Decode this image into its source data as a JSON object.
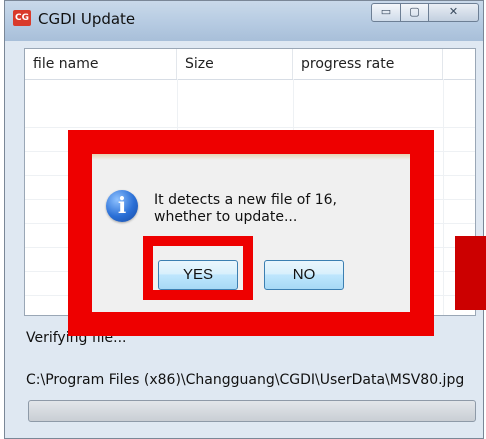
{
  "window": {
    "title": "CGDI Update",
    "icon_text": "CG",
    "min_glyph": "▭",
    "max_glyph": "▢",
    "close_glyph": "✕"
  },
  "list": {
    "columns": [
      "file name",
      "Size",
      "progress rate"
    ]
  },
  "status": {
    "text": "Verifying file...",
    "path": "C:\\Program Files (x86)\\Changguang\\CGDI\\UserData\\MSV80.jpg",
    "progress": 0
  },
  "dialog": {
    "icon": "info-icon",
    "icon_glyph": "i",
    "message": "It detects a new file of 16, whether to update...",
    "yes_label": "YES",
    "no_label": "NO"
  },
  "colors": {
    "highlight": "#ee0000",
    "button_border": "#3c7fb1"
  }
}
